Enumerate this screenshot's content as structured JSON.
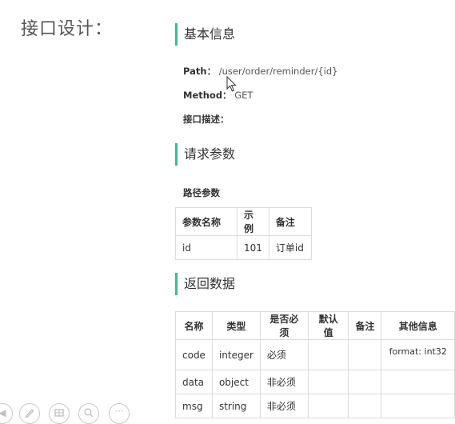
{
  "slide": {
    "title": "接口设计："
  },
  "basic": {
    "heading": "基本信息",
    "path_label": "Path：",
    "path_value": "/user/order/reminder/{id}",
    "method_label": "Method：",
    "method_value": "GET",
    "desc_label": "接口描述："
  },
  "request": {
    "heading": "请求参数",
    "path_params_title": "路径参数",
    "columns": [
      "参数名称",
      "示例",
      "备注"
    ],
    "rows": [
      [
        "id",
        "101",
        "订单id"
      ]
    ]
  },
  "response": {
    "heading": "返回数据",
    "columns": [
      "名称",
      "类型",
      "是否必须",
      "默认值",
      "备注",
      "其他信息"
    ],
    "rows": [
      [
        "code",
        "integer",
        "必须",
        "",
        "",
        "format: int32"
      ],
      [
        "data",
        "object",
        "非必须",
        "",
        "",
        ""
      ],
      [
        "msg",
        "string",
        "非必须",
        "",
        "",
        ""
      ]
    ]
  },
  "toolbar": {
    "icons": [
      "previous-icon",
      "pen-icon",
      "slides-icon",
      "zoom-icon",
      "more-icon"
    ]
  }
}
